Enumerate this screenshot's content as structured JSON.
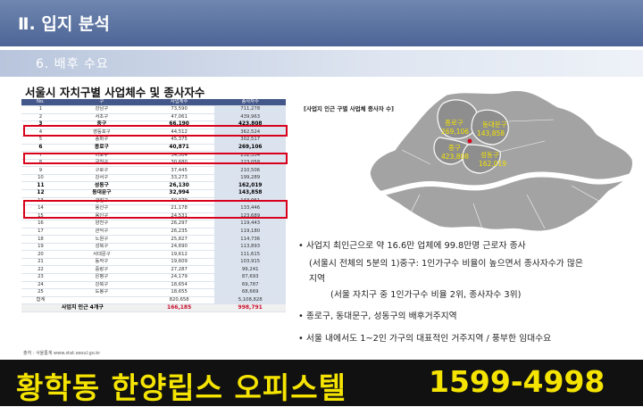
{
  "header": {
    "title": "Ⅱ. 입지 분석"
  },
  "subheader": {
    "title": "6. 배후 수요"
  },
  "section_title": "서울시 자치구별 사업체수 및 종사자수",
  "table": {
    "columns": [
      "No.",
      "구",
      "사업체수",
      "종사자수"
    ],
    "rows": [
      [
        "1",
        "강남구",
        "73,590",
        "711,278"
      ],
      [
        "2",
        "서초구",
        "47,061",
        "439,963"
      ],
      [
        "3",
        "중구",
        "66,190",
        "423,808"
      ],
      [
        "4",
        "영등포구",
        "44,512",
        "362,524"
      ],
      [
        "5",
        "송파구",
        "45,375",
        "302,517"
      ],
      [
        "6",
        "종로구",
        "40,871",
        "269,106"
      ],
      [
        "7",
        "마포구",
        "34,504",
        "252,534"
      ],
      [
        "8",
        "금천구",
        "30,680",
        "223,058"
      ],
      [
        "9",
        "구로구",
        "37,445",
        "210,506"
      ],
      [
        "10",
        "강서구",
        "33,273",
        "199,289"
      ],
      [
        "11",
        "성동구",
        "26,130",
        "162,019"
      ],
      [
        "12",
        "동대문구",
        "32,994",
        "143,858"
      ],
      [
        "13",
        "광진구",
        "30,079",
        "143,061"
      ],
      [
        "14",
        "용산구",
        "21,178",
        "133,446"
      ],
      [
        "15",
        "용인구",
        "24,531",
        "123,689"
      ],
      [
        "16",
        "양천구",
        "26,297",
        "119,443"
      ],
      [
        "17",
        "관악구",
        "26,235",
        "119,180"
      ],
      [
        "18",
        "노원구",
        "25,827",
        "114,736"
      ],
      [
        "19",
        "성북구",
        "24,690",
        "113,893"
      ],
      [
        "20",
        "서대문구",
        "19,612",
        "111,615"
      ],
      [
        "21",
        "동작구",
        "19,609",
        "103,915"
      ],
      [
        "22",
        "중랑구",
        "27,287",
        "99,241"
      ],
      [
        "23",
        "은평구",
        "24,179",
        "87,693"
      ],
      [
        "24",
        "강북구",
        "18,654",
        "69,787"
      ],
      [
        "25",
        "도봉구",
        "18,655",
        "68,669"
      ],
      [
        "합계",
        "",
        "820,658",
        "5,108,828"
      ]
    ],
    "highlight_rows": [
      2,
      5,
      10,
      11
    ],
    "total": {
      "label": "사업지 인근 4개구",
      "businesses": "166,185",
      "workers": "998,791"
    }
  },
  "source": "출처 : 서울통계 www.stat.seoul.go.kr",
  "map": {
    "label": "[사업지 인근 구별 사업체 종사자 수]",
    "districts": [
      {
        "name": "종로구",
        "value": "269,106"
      },
      {
        "name": "동대문구",
        "value": "143,858"
      },
      {
        "name": "중구",
        "value": "423,808"
      },
      {
        "name": "성동구",
        "value": "162,019"
      }
    ],
    "colors": {
      "land": "#a3a3a3",
      "highlight": "#8e8e8e",
      "river": "#ffffff",
      "text": "#f5e400"
    }
  },
  "bullets": {
    "b1": "사업지 최인근으로 약 16.6만 업체에 99.8만명 근로자 종사",
    "b1_l2": "(서울시 전체의 5분의 1)중구: 1인가구수 비율이 높으면서 종사자수가 많은",
    "b1_l3": "지역",
    "b1_l4": "(서울 자치구 중 1인가구수 비율 2위, 종사자수 3위)",
    "b2": "종로구, 동대문구, 성동구의 배후거주지역",
    "b3": "서울 내에서도 1~2인 가구의 대표적인 거주지역 / 풍부한 임대수요"
  },
  "banner": {
    "name": "황학동 한양립스 오피스텔",
    "phone": "1599-4998"
  }
}
